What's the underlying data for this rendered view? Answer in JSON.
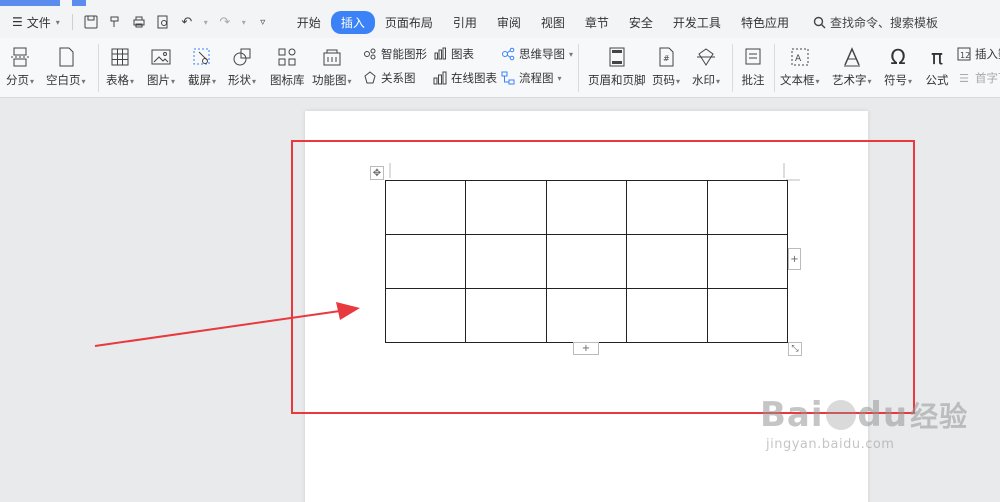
{
  "menubar": {
    "file_label": "文件",
    "tabs": [
      {
        "label": "开始",
        "active": false
      },
      {
        "label": "插入",
        "active": true
      },
      {
        "label": "页面布局",
        "active": false
      },
      {
        "label": "引用",
        "active": false
      },
      {
        "label": "审阅",
        "active": false
      },
      {
        "label": "视图",
        "active": false
      },
      {
        "label": "章节",
        "active": false
      },
      {
        "label": "安全",
        "active": false
      },
      {
        "label": "开发工具",
        "active": false
      },
      {
        "label": "特色应用",
        "active": false
      }
    ],
    "search_label": "查找命令、搜索模板"
  },
  "ribbon": {
    "page_break": "分页",
    "blank_page": "空白页",
    "table": "表格",
    "picture": "图片",
    "screenshot": "截屏",
    "shape": "形状",
    "icon_lib": "图标库",
    "func_chart": "功能图",
    "smart_graphic": "智能图形",
    "chart": "图表",
    "mindmap": "思维导图",
    "relation": "关系图",
    "online_chart": "在线图表",
    "flowchart": "流程图",
    "header_footer": "页眉和页脚",
    "page_number": "页码",
    "watermark": "水印",
    "comment": "批注",
    "textbox": "文本框",
    "art_text": "艺术字",
    "symbol": "符号",
    "formula": "公式",
    "insert_num": "插入数",
    "first_char": "首字下"
  },
  "document": {
    "table_rows": 3,
    "table_cols": 5
  },
  "watermark": {
    "brand": "Bai",
    "brand2": "du",
    "brand_cn": "经验",
    "url": "jingyan.baidu.com"
  },
  "colors": {
    "active_tab": "#3b82f6",
    "highlight_box": "#e8393f",
    "arrow": "#e8393f"
  }
}
